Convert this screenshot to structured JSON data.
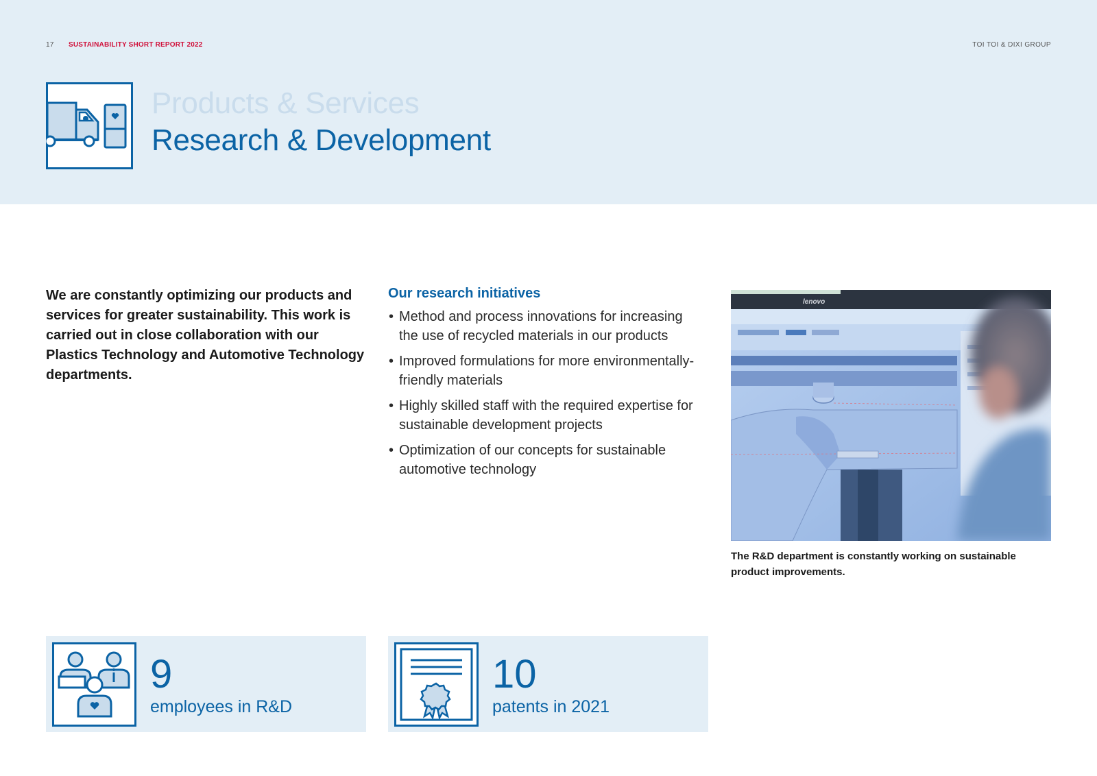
{
  "header": {
    "page_number": "17",
    "report_title": "SUSTAINABILITY SHORT REPORT 2022",
    "group_name": "TOI TOI & DIXI GROUP",
    "section": "Products & Services",
    "title": "Research & Development",
    "icon": "truck-and-toilet-icon"
  },
  "intro": {
    "text": "We are constantly optimizing our products and services for greater sustainability. This work is carried out in close collaboration with our Plastics Technology and Automotive Technology departments."
  },
  "initiatives": {
    "title": "Our research initiatives",
    "items": [
      "Method and process innovations for increasing the use of recycled materials in our products",
      "Improved formulations for more environmentally-friendly materials",
      "Highly skilled staff with the required expertise for sustainable development projects",
      "Optimization of our concepts for sustainable automotive technology"
    ]
  },
  "photo": {
    "caption": "The R&D department is constantly working on sustainable product improvements.",
    "monitor_brand": "lenovo"
  },
  "stats": [
    {
      "value": "9",
      "label": "employees in R&D",
      "icon": "people-icon"
    },
    {
      "value": "10",
      "label": "patents in 2021",
      "icon": "certificate-icon"
    }
  ],
  "colors": {
    "accent_blue": "#0b63a5",
    "light_band": "#e3eef6",
    "report_red": "#d0103a",
    "faded_title": "#c9dcec"
  }
}
